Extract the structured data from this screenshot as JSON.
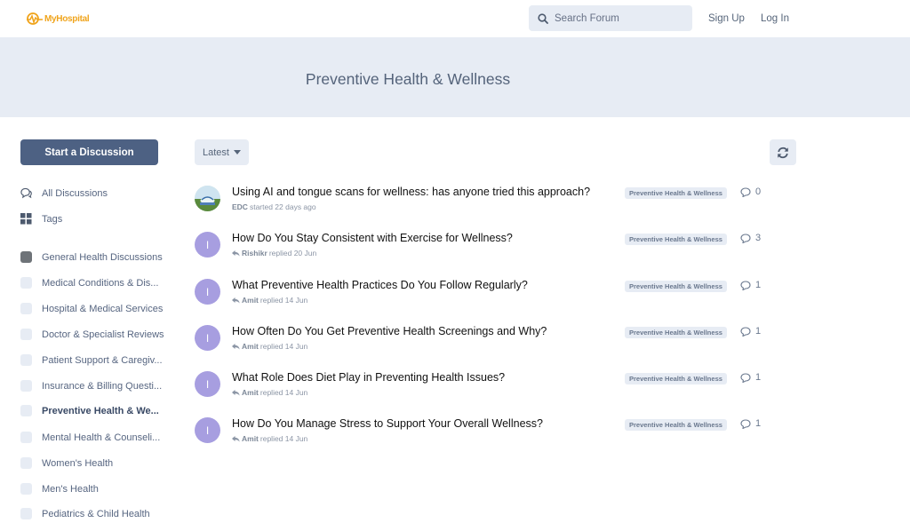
{
  "header": {
    "logo_text": "MyHospital",
    "search_placeholder": "Search Forum",
    "signup_label": "Sign Up",
    "login_label": "Log In"
  },
  "hero": {
    "title": "Preventive Health & Wellness"
  },
  "sidebar": {
    "start_label": "Start a Discussion",
    "nav": [
      {
        "label": "All Discussions",
        "icon": "comments-icon"
      },
      {
        "label": "Tags",
        "icon": "tags-grid-icon"
      }
    ],
    "tags": [
      {
        "label": "General Health Discussions"
      },
      {
        "label": "Medical Conditions & Dis..."
      },
      {
        "label": "Hospital & Medical Services"
      },
      {
        "label": "Doctor & Specialist Reviews"
      },
      {
        "label": "Patient Support & Caregiv..."
      },
      {
        "label": "Insurance & Billing Questi..."
      },
      {
        "label": "Preventive Health & We..."
      },
      {
        "label": "Mental Health & Counseli..."
      },
      {
        "label": "Women's Health"
      },
      {
        "label": "Men's Health"
      },
      {
        "label": "Pediatrics & Child Health"
      }
    ]
  },
  "toolbar": {
    "sort_label": "Latest"
  },
  "discussions": [
    {
      "title": "Using AI and tongue scans for wellness: has anyone tried this approach?",
      "user": "EDC",
      "action": "started 22 days ago",
      "tag": "Preventive Health & Wellness",
      "count": "0",
      "avatar": ""
    },
    {
      "title": "How Do You Stay Consistent with Exercise for Wellness?",
      "user": "Rishikr",
      "action": "replied 20 Jun",
      "tag": "Preventive Health & Wellness",
      "count": "3",
      "avatar": "I"
    },
    {
      "title": "What Preventive Health Practices Do You Follow Regularly?",
      "user": "Amit",
      "action": "replied 14 Jun",
      "tag": "Preventive Health & Wellness",
      "count": "1",
      "avatar": "I"
    },
    {
      "title": "How Often Do You Get Preventive Health Screenings and Why?",
      "user": "Amit",
      "action": "replied 14 Jun",
      "tag": "Preventive Health & Wellness",
      "count": "1",
      "avatar": "I"
    },
    {
      "title": "What Role Does Diet Play in Preventing Health Issues?",
      "user": "Amit",
      "action": "replied 14 Jun",
      "tag": "Preventive Health & Wellness",
      "count": "1",
      "avatar": "I"
    },
    {
      "title": "How Do You Manage Stress to Support Your Overall Wellness?",
      "user": "Amit",
      "action": "replied 14 Jun",
      "tag": "Preventive Health & Wellness",
      "count": "1",
      "avatar": "I"
    }
  ],
  "colors": {
    "accent": "#4d6183",
    "hero_bg": "#e7ecf4",
    "avatar": "#a79ee0",
    "logo": "#f0a41c"
  }
}
